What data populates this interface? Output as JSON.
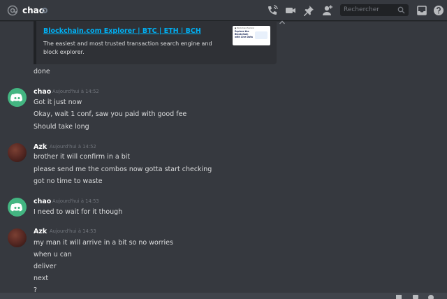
{
  "header": {
    "channel_name": "chao",
    "search_placeholder": "Rechercher",
    "icons": [
      "at-icon",
      "phone-call-icon",
      "video-call-icon",
      "pin-icon",
      "add-member-icon",
      "search-icon",
      "inbox-icon",
      "help-icon"
    ]
  },
  "embed": {
    "link_text": "Blockchain.com Explorer | BTC | ETH | BCH",
    "description": "The easiest and most trusted transaction search engine and block explorer.",
    "thumbnail_top": "■ Blockchain   Explorer",
    "thumbnail_text": "Explore the Blockchain with Live Data"
  },
  "messages": {
    "done": "done",
    "g1": {
      "author": "chao",
      "timestamp": "Aujourd'hui à 14:52",
      "lines": [
        "Got it just now",
        "Okay, wait 1 conf, saw you paid with good fee",
        "Should take long"
      ]
    },
    "g2": {
      "author": "Azk",
      "timestamp": "Aujourd'hui à 14:52",
      "lines": [
        "brother it will confirm in a bit",
        "please send me the combos now gotta start checking",
        "got no time to waste"
      ]
    },
    "g3": {
      "author": "chao",
      "timestamp": "Aujourd'hui à 14:53",
      "lines": [
        "I need to wait for it though"
      ]
    },
    "g4": {
      "author": "Azk",
      "timestamp": "Aujourd'hui à 14:53",
      "lines": [
        "my man it will arrive in a bit  so no worries",
        "when u can",
        "deliver",
        "next",
        "?"
      ]
    }
  },
  "colors": {
    "background": "#36393f",
    "header_text": "#ffffff",
    "link": "#00b0f4",
    "timestamp": "#72767d",
    "discord_avatar": "#43b581",
    "search_bg": "#202225"
  }
}
